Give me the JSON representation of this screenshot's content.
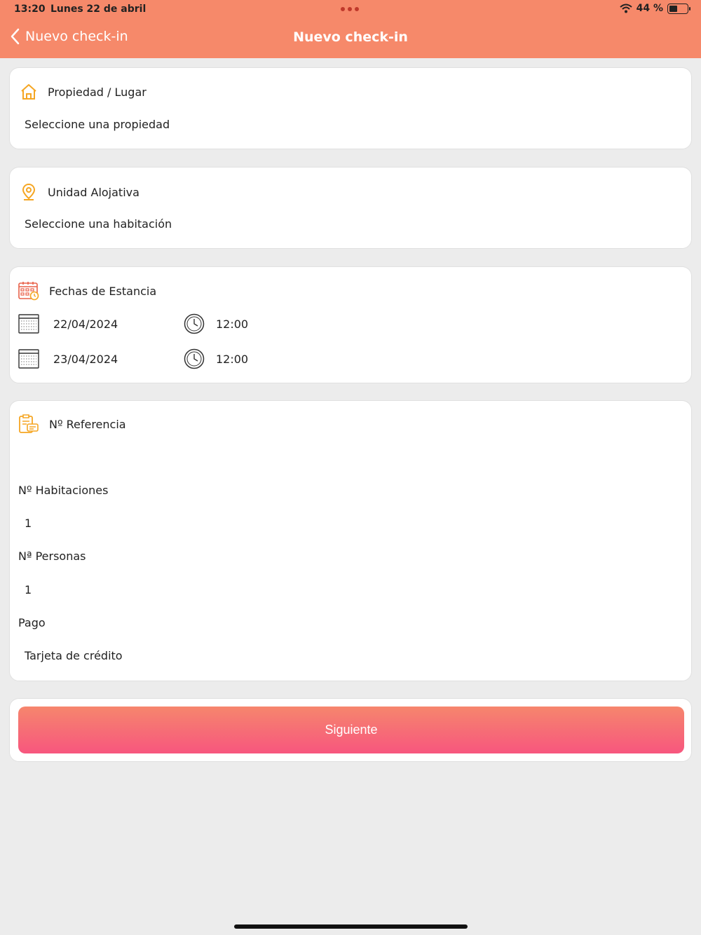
{
  "status": {
    "time": "13:20",
    "date": "Lunes 22 de abril",
    "battery": "44 %",
    "battery_level": 0.44
  },
  "nav": {
    "back_label": "Nuevo check-in",
    "title": "Nuevo check-in"
  },
  "property": {
    "title": "Propiedad / Lugar",
    "value": "Seleccione una propiedad"
  },
  "unit": {
    "title": "Unidad Alojativa",
    "value": "Seleccione una habitación"
  },
  "dates": {
    "title": "Fechas de Estancia",
    "checkin": {
      "date": "22/04/2024",
      "time": "12:00"
    },
    "checkout": {
      "date": "23/04/2024",
      "time": "12:00"
    }
  },
  "reference": {
    "title": "Nº Referencia",
    "value": "",
    "rooms_label": "Nº Habitaciones",
    "rooms_value": "1",
    "people_label": "Nª Personas",
    "people_value": "1",
    "payment_label": "Pago",
    "payment_value": "Tarjeta de crédito"
  },
  "actions": {
    "next_label": "Siguiente"
  },
  "colors": {
    "header": "#f6896a",
    "accent_orange": "#f5a623",
    "button_top": "#f6866d",
    "button_bottom": "#f7567e"
  },
  "icons": [
    "chevron-left-icon",
    "wifi-icon",
    "battery-icon",
    "home-icon",
    "location-pin-icon",
    "calendar-icon",
    "calendar-small-icon",
    "clock-icon",
    "reference-icon"
  ]
}
